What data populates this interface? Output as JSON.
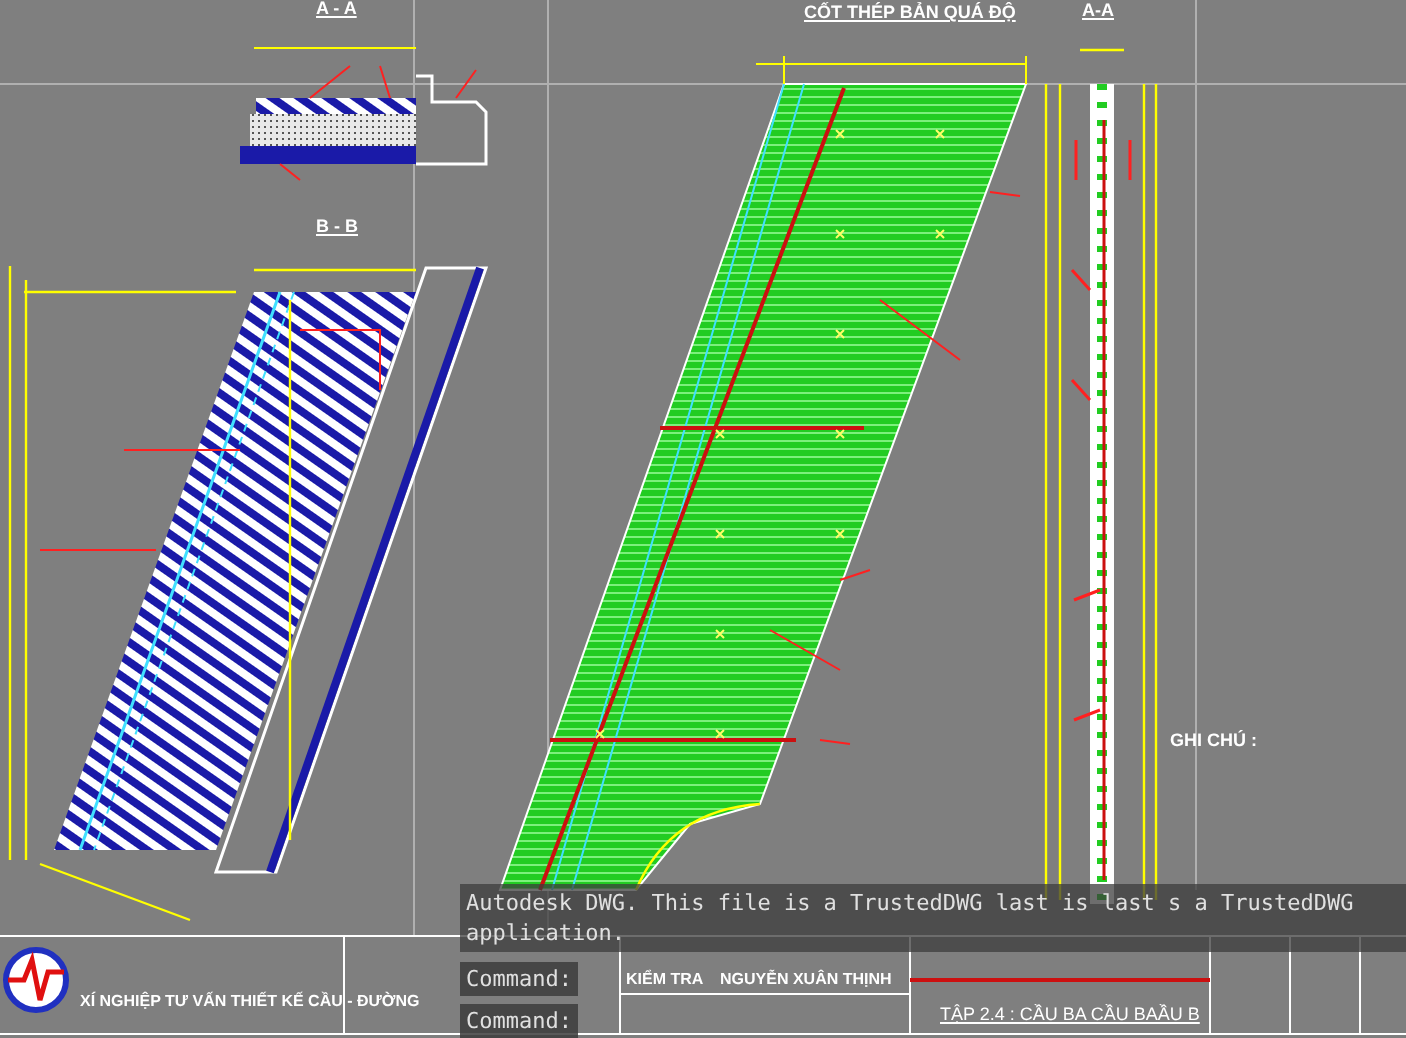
{
  "section_aa": {
    "title": "A - A"
  },
  "section_bb": {
    "title": "B - B"
  },
  "rebar_plan": {
    "title": "CỐT THÉP BẢN QUÁ ĐỘ"
  },
  "rebar_section": {
    "title": "A-A"
  },
  "notes": {
    "title": "GHI CHÚ :"
  },
  "title_block": {
    "company": "XÍ NGHIỆP TƯ VẤN THIẾT KẾ CẦU - ĐƯỜNG",
    "checker_label": "KIỂM TRA",
    "checker_name": "NGUYỄN XUÂN THỊNH",
    "sheet_title": "TẬP 2.4 : CẦU BA CẦU BAẦU B"
  },
  "command_line": {
    "message": [
      "Autodesk DWG.  This file is a TrustedDWG last is last s a TrustedDWG",
      "application."
    ],
    "prompts": [
      "Command:",
      "Command:"
    ]
  }
}
